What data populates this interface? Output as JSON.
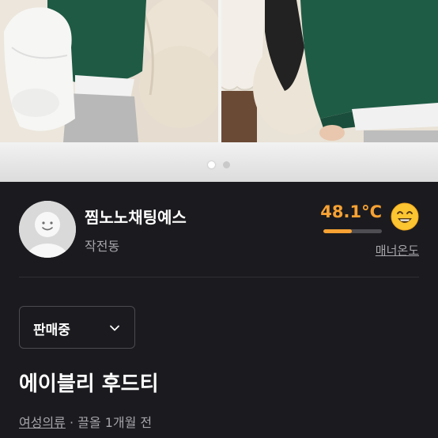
{
  "carousel": {
    "image_count": 2,
    "active_index": 0
  },
  "seller": {
    "name": "찜노노채팅예스",
    "location": "작전동",
    "avatar_icon": "user-avatar-icon"
  },
  "manner": {
    "temperature": "48.1°C",
    "temperature_level": 0.481,
    "label": "매너온도",
    "face_icon": "smiling-face-icon",
    "color": "#f7a233"
  },
  "status": {
    "selected": "판매중",
    "icon": "chevron-down-icon"
  },
  "product": {
    "title": "에이블리 후드티",
    "category": "여성의류",
    "separator": "·",
    "bumped": "끌올 1개월 전"
  },
  "colors": {
    "background": "#1b1b1f",
    "accent": "#f7a233",
    "muted_text": "#a5a5aa"
  }
}
